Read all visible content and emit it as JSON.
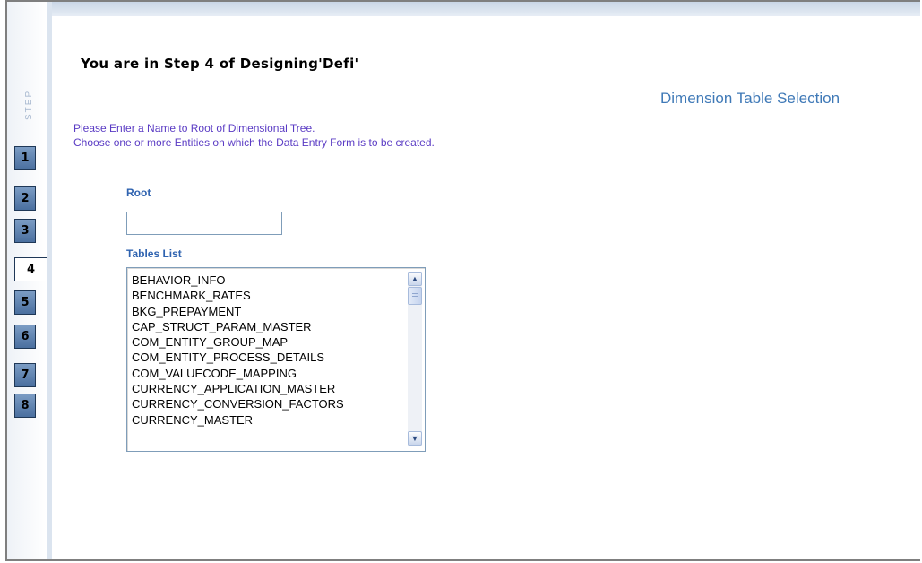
{
  "sidebar": {
    "step_label": "STEP",
    "steps": [
      "1",
      "2",
      "3",
      "4",
      "5",
      "6",
      "7",
      "8"
    ],
    "active_step": "4"
  },
  "page": {
    "title": "You are in Step 4 of Designing'Defi'",
    "section_title": "Dimension Table Selection",
    "instruction_1": "Please Enter a Name to Root of Dimensional Tree.",
    "instruction_2": "Choose one or more Entities on which the Data Entry Form is to be created."
  },
  "form": {
    "root_label": "Root",
    "root_value": "",
    "tables_label": "Tables List",
    "tables": [
      "BEHAVIOR_INFO",
      "BENCHMARK_RATES",
      "BKG_PREPAYMENT",
      "CAP_STRUCT_PARAM_MASTER",
      "COM_ENTITY_GROUP_MAP",
      "COM_ENTITY_PROCESS_DETAILS",
      "COM_VALUECODE_MAPPING",
      "CURRENCY_APPLICATION_MASTER",
      "CURRENCY_CONVERSION_FACTORS",
      "CURRENCY_MASTER"
    ]
  },
  "icons": {
    "scroll_up": "chevron-up-icon",
    "scroll_down": "chevron-down-icon"
  }
}
